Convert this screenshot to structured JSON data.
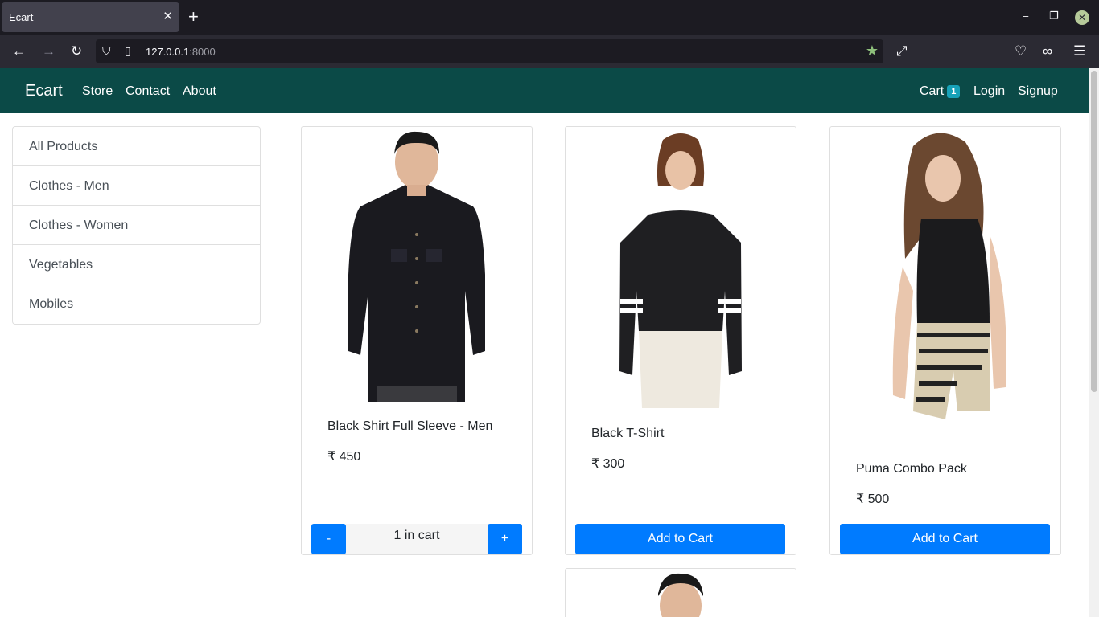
{
  "browser": {
    "tab_title": "Ecart",
    "url_host": "127.0.0.1",
    "url_port": ":8000"
  },
  "site": {
    "brand": "Ecart",
    "nav": {
      "store": "Store",
      "contact": "Contact",
      "about": "About"
    },
    "right_nav": {
      "cart": "Cart",
      "cart_count": "1",
      "login": "Login",
      "signup": "Signup"
    }
  },
  "sidebar": {
    "items": [
      {
        "label": "All Products"
      },
      {
        "label": "Clothes - Men"
      },
      {
        "label": "Clothes - Women"
      },
      {
        "label": "Vegetables"
      },
      {
        "label": "Mobiles"
      }
    ]
  },
  "products": [
    {
      "name": "Black Shirt Full Sleeve - Men",
      "price": "₹ 450",
      "cart_text": "1 in cart",
      "minus": "-",
      "plus": "+"
    },
    {
      "name": "Black T-Shirt",
      "price": "₹ 300",
      "button": "Add to Cart"
    },
    {
      "name": "Puma Combo Pack",
      "price": "₹ 500",
      "button": "Add to Cart"
    }
  ]
}
